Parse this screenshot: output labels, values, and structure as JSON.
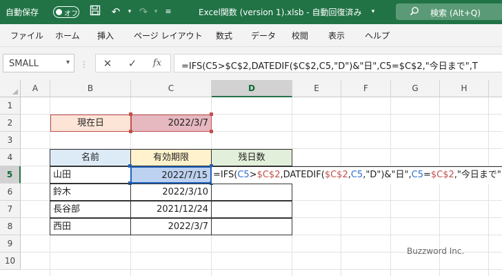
{
  "titlebar": {
    "autosave_label": "自動保存",
    "autosave_state": "オフ",
    "file_title": "Excel関数 (version 1).xlsb - 自動回復済み",
    "title_dropdown_icon": "chevron-down-icon",
    "search_label": "検索 (Alt+Q)",
    "icons": [
      "save-icon",
      "undo-icon",
      "redo-icon",
      "customize-icon",
      "search-icon"
    ]
  },
  "ribbon": {
    "tabs": [
      "ファイル",
      "ホーム",
      "挿入",
      "ページ レイアウト",
      "数式",
      "データ",
      "校閲",
      "表示",
      "ヘルプ"
    ]
  },
  "formula_bar": {
    "name_box": "SMALL",
    "formula_text": "=IFS(C5>$C$2,DATEDIF($C$2,C5,\"D\")&\"日\",C5=$C$2,\"今日まで\",T",
    "buttons": [
      "cancel-icon",
      "enter-icon",
      "insert-function-icon"
    ],
    "fx_label": "fx"
  },
  "grid": {
    "columns": [
      "A",
      "B",
      "C",
      "D",
      "E",
      "F",
      "G",
      "H"
    ],
    "rows": [
      "1",
      "2",
      "3",
      "4",
      "5",
      "6",
      "7",
      "8",
      "9",
      "10"
    ],
    "selected_column": "D",
    "selected_row": "5"
  },
  "sheet": {
    "B2": "現在日",
    "C2": "2022/3/7",
    "B4": "名前",
    "C4": "有効期限",
    "D4": "残日数",
    "rows": [
      {
        "name": "山田",
        "date": "2022/7/15"
      },
      {
        "name": "鈴木",
        "date": "2022/3/10"
      },
      {
        "name": "長谷部",
        "date": "2021/12/24"
      },
      {
        "name": "西田",
        "date": "2022/3/7"
      }
    ],
    "D5_edit": {
      "p1": "=IFS(",
      "p2": "C5",
      "p3": ">",
      "p4": "$C$2",
      "p5": ",DATEDIF(",
      "p6": "$C$2",
      "p7": ",",
      "p8": "C5",
      "p9": ",\"D\")&\"日\",",
      "p10": "C5",
      "p11": "=",
      "p12": "$C$2",
      "p13": ",\"今日まで\""
    }
  },
  "colors": {
    "accent": "#217346",
    "b2_fill": "#fce4d6",
    "c2_fill": "#e6b8c0",
    "b4_fill": "#ddebf7",
    "c4_fill": "#fff2cc",
    "d4_fill": "#e2efda",
    "c5_fill": "#bdd1f0"
  },
  "watermark": "Buzzword Inc."
}
